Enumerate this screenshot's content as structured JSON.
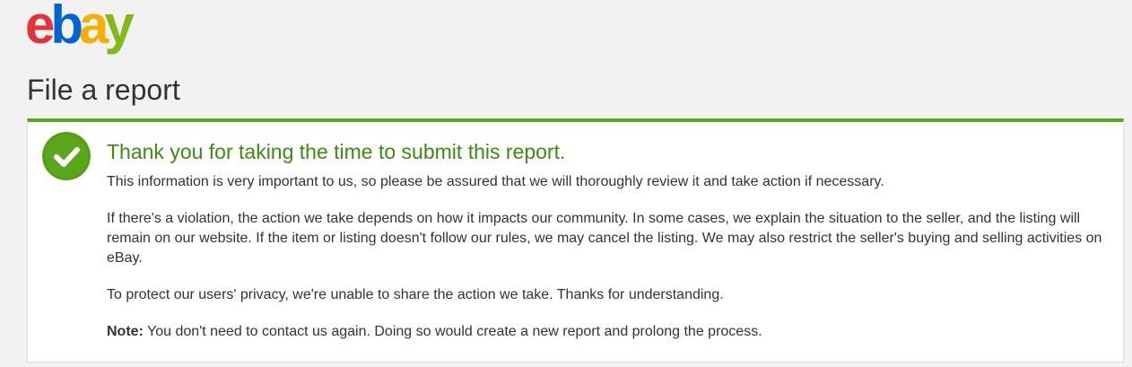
{
  "brand": {
    "logo_letters": [
      "e",
      "b",
      "a",
      "y"
    ],
    "logo_colors": [
      "#e53238",
      "#0064d2",
      "#f5af02",
      "#86b817"
    ]
  },
  "page": {
    "title": "File a report"
  },
  "confirmation": {
    "icon": "check-circle-icon",
    "success_color": "#5ba71b",
    "heading": "Thank you for taking the time to submit this report.",
    "paragraph_1": "This information is very important to us, so please be assured that we will thoroughly review it and take action if necessary.",
    "paragraph_2": "If there's a violation, the action we take depends on how it impacts our community. In some cases, we explain the situation to the seller, and the listing will remain on our website. If the item or listing doesn't follow our rules, we may cancel the listing. We may also restrict the seller's buying and selling activities on eBay.",
    "paragraph_3": "To protect our users' privacy, we're unable to share the action we take. Thanks for understanding.",
    "note_label": "Note:",
    "note_text": " You don't need to contact us again. Doing so would create a new report and prolong the process."
  }
}
